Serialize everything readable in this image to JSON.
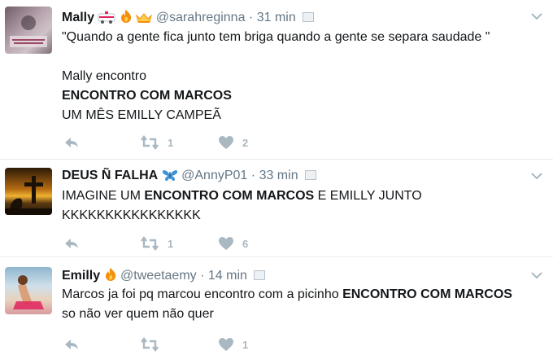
{
  "tweets": [
    {
      "name": "Mally",
      "emoji": [
        "ambulance-emoji",
        "fire-emoji",
        "crown-emoji"
      ],
      "handle": "@sarahreginna",
      "separator": "·",
      "time": "31 min",
      "lines": [
        "\"Quando a gente fica junto tem briga quando a gente se separa saudade \"",
        "",
        "Mally encontro"
      ],
      "bold_line": "ENCONTRO COM MARCOS",
      "last_line": "UM MÊS EMILLY CAMPEÃ",
      "retweets": "1",
      "likes": "2"
    },
    {
      "name": "DEUS Ñ FALHA",
      "emoji": [
        "butterfly-emoji"
      ],
      "handle": "@AnnyP01",
      "separator": "·",
      "time": "33 min",
      "text_pre": "IMAGINE UM ",
      "text_bold": "ENCONTRO COM MARCOS",
      "text_post": " E EMILLY JUNTO",
      "line2": "KKKKKKKKKKKKKKKK",
      "retweets": "1",
      "likes": "6"
    },
    {
      "name": "Emilly",
      "emoji": [
        "fire-emoji"
      ],
      "handle": "@tweetaemy",
      "separator": "·",
      "time": "14 min",
      "text_pre": "Marcos ja foi pq marcou encontro com a picinho ",
      "text_bold": "ENCONTRO COM MARCOS",
      "line2": "so não ver quem não quer",
      "retweets": "",
      "likes": "1"
    }
  ],
  "colors": {
    "text": "#14171a",
    "secondary": "#657786",
    "icon": "#aab8c2",
    "border": "#e6ecf0"
  }
}
